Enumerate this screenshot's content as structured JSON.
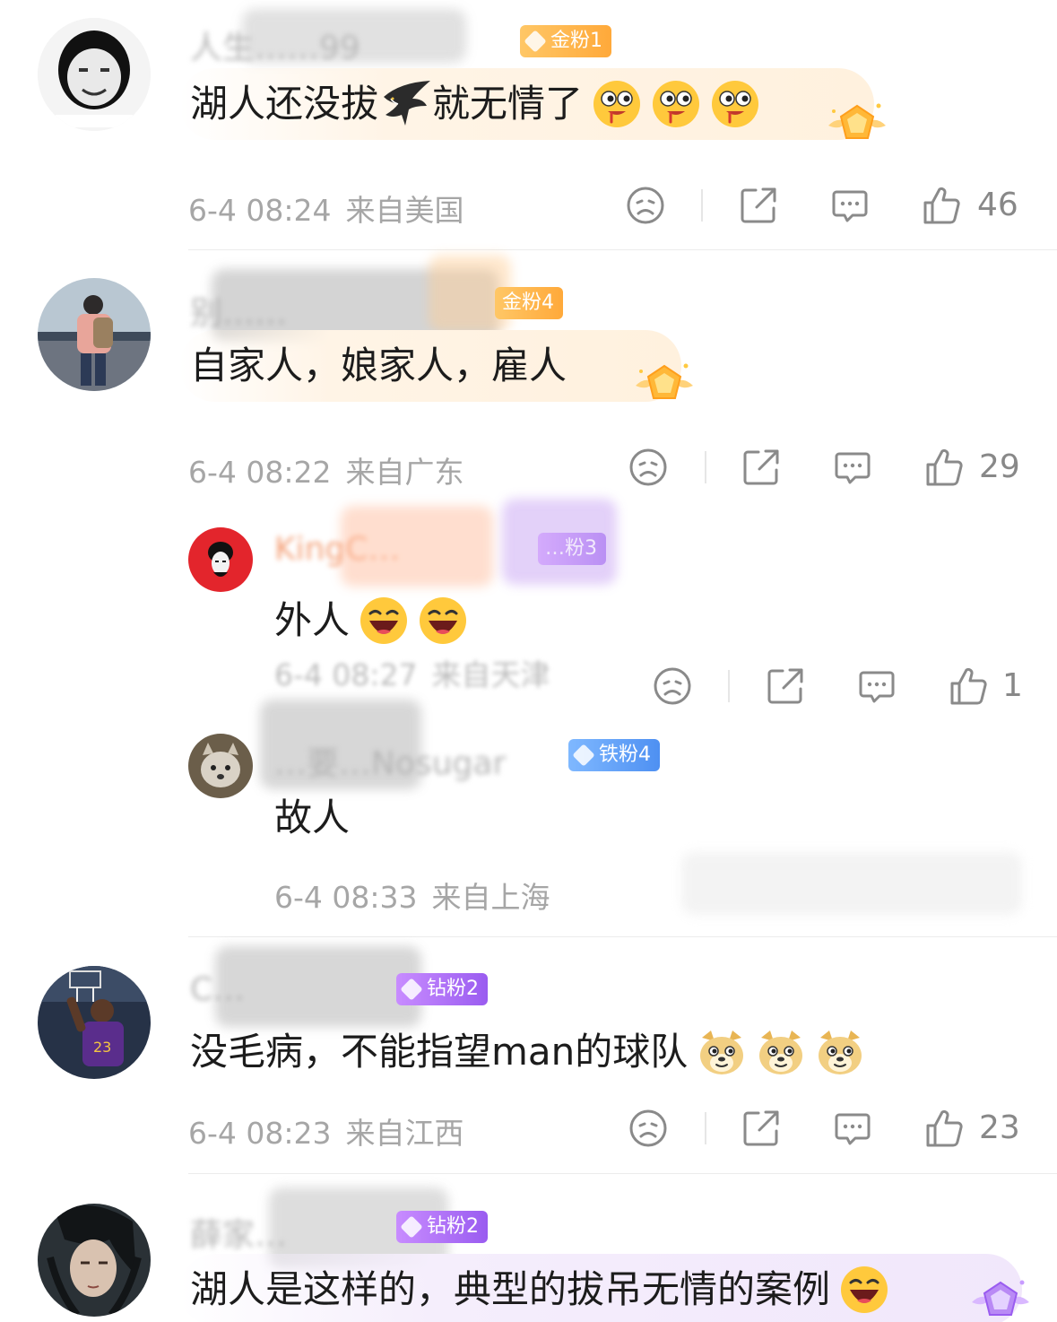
{
  "comments": [
    {
      "username": "人生……99",
      "badge": "金粉1",
      "text": "湖人还没拔",
      "text_after": "就无情了",
      "meta_time": "6-4 08:24",
      "meta_loc": "来自美国",
      "likes": "46"
    },
    {
      "username": "别……",
      "badge": "金粉4",
      "text": "自家人，娘家人，雇人",
      "meta_time": "6-4 08:22",
      "meta_loc": "来自广东",
      "likes": "29",
      "replies": [
        {
          "username": "KingC…",
          "badge": "…粉3",
          "text": "外人",
          "meta_time": "6-4 08:27",
          "meta_loc": "来自天津",
          "likes": "1"
        },
        {
          "username": "…要…Nosugar",
          "badge": "铁粉4",
          "text": "故人",
          "meta_time": "6-4 08:33",
          "meta_loc": "来自上海"
        }
      ]
    },
    {
      "username": "C…",
      "badge": "钻粉2",
      "text": "没毛病，不能指望man的球队",
      "meta_time": "6-4 08:23",
      "meta_loc": "来自江西",
      "likes": "23"
    },
    {
      "username": "薛家…",
      "badge": "钻粉2",
      "text": "湖人是这样的，典型的拔吊无情的案例"
    }
  ],
  "icons": {
    "dislike": "frown-face-icon",
    "share": "share-icon",
    "reply": "comment-bubble-icon",
    "like": "thumbs-up-icon"
  },
  "colors": {
    "gold_badge": "#ffa93a",
    "iron_badge": "#4e90f2",
    "diamond_badge": "#9a5cf0",
    "meta_text": "#a6a6a6"
  }
}
